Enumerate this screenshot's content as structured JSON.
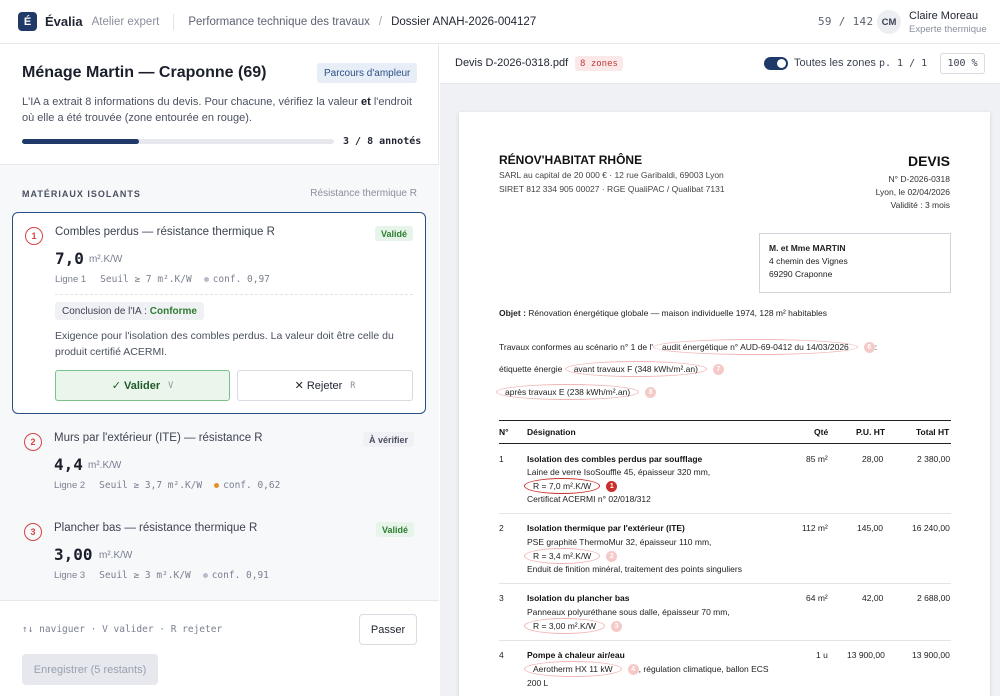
{
  "header": {
    "logo_letter": "É",
    "brand": "Évalia",
    "brand_sub": "Atelier expert",
    "crumb1": "Performance technique des travaux",
    "crumb_sep": "/",
    "crumb2": "Dossier ANAH-2026-004127",
    "counter": "59 / 142",
    "avatar": "CM",
    "user_name": "Claire Moreau",
    "user_role": "Experte thermique"
  },
  "case": {
    "title": "Ménage Martin — Craponne (69)",
    "tag": "Parcours d'ampleur",
    "intro_a": "L'IA a extrait 8 informations du devis. Pour chacune, vérifiez la valeur ",
    "intro_b": "et",
    "intro_c": " l'endroit où elle a été trouvée (zone entourée en rouge).",
    "progress_fraction": 0.375,
    "progress_label": "3 / 8 annotés"
  },
  "section": {
    "title": "MATÉRIAUX ISOLANTS",
    "unit": "Résistance thermique R"
  },
  "items": [
    {
      "num": "1",
      "title": "Combles perdus — résistance thermique R",
      "status": "Validé",
      "value": "7,0",
      "unit": "m².K/W",
      "line": "Ligne 1",
      "threshold": "Seuil ≥ 7 m².K/W",
      "conf": "conf. 0,97",
      "ia_label": "Conclusion de l'IA :",
      "ia_value": "Conforme",
      "ia_text": "Exigence pour l'isolation des combles perdus. La valeur doit être celle du produit certifié ACERMI.",
      "validate_label": "✓ Valider",
      "validate_key": "V",
      "reject_label": "✕ Rejeter",
      "reject_key": "R"
    },
    {
      "num": "2",
      "title": "Murs par l'extérieur (ITE) — résistance R",
      "status": "À vérifier",
      "value": "4,4",
      "unit": "m².K/W",
      "line": "Ligne 2",
      "threshold": "Seuil ≥ 3,7 m².K/W",
      "conf": "conf. 0,62"
    },
    {
      "num": "3",
      "title": "Plancher bas — résistance thermique R",
      "status": "Validé",
      "value": "3,00",
      "unit": "m².K/W",
      "line": "Ligne 3",
      "threshold": "Seuil ≥ 3 m².K/W",
      "conf": "conf. 0,91"
    }
  ],
  "footer": {
    "hint": "↑↓ naviguer · V valider · R rejeter",
    "skip": "Passer",
    "save": "Enregistrer (5 restants)"
  },
  "viewer": {
    "doc_name": "Devis D-2026-0318.pdf",
    "zones": "8 zones",
    "toggle_label": "Toutes les zones",
    "page": "p. 1 / 1",
    "zoom": "100 %"
  },
  "doc": {
    "company": "RÉNOV'HABITAT RHÔNE",
    "company_l1": "SARL au capital de 20 000 € · 12 rue Garibaldi, 69003 Lyon",
    "company_l2": "SIRET 812 334 905 00027 · RGE QualiPAC / Qualibat 7131",
    "devis": "DEVIS",
    "devis_no": "N° D-2026-0318",
    "devis_date": "Lyon, le 02/04/2026",
    "devis_valid": "Validité : 3 mois",
    "client_name": "M. et Mme MARTIN",
    "client_addr1": "4 chemin des Vignes",
    "client_addr2": "69290 Craponne",
    "objet_label": "Objet :",
    "objet": "Rénovation énergétique globale — maison individuelle 1974, 128 m² habitables",
    "scenario_pre": "Travaux conformes au scénario n° 1 de l'",
    "scenario_hl": "audit énergétique n° AUD-69-0412 du 14/03/2026",
    "scenario_zone": "6",
    "scenario_post": ":",
    "etiq_pre": "étiquette énergie",
    "etiq_hl": "avant travaux F (348 kWh/m².an)",
    "etiq_zone": "7",
    "after_hl": "après travaux E (238 kWh/m².an)",
    "after_zone": "8",
    "cols": [
      "N°",
      "Désignation",
      "Qté",
      "P.U. HT",
      "Total HT"
    ],
    "rows": [
      {
        "no": "1",
        "title": "Isolation des combles perdus par soufflage",
        "l1": "Laine de verre IsoSouffle 45, épaisseur 320 mm,",
        "hl": "R = 7,0 m².K/W",
        "zone": "1",
        "l3": "Certificat ACERMI n° 02/018/312",
        "qty": "85 m²",
        "pu": "28,00",
        "total": "2 380,00"
      },
      {
        "no": "2",
        "title": "Isolation thermique par l'extérieur (ITE)",
        "l1": "PSE graphité ThermoMur 32, épaisseur 110 mm,",
        "hl": "R = 3,4 m².K/W",
        "zone": "2",
        "l3": "Enduit de finition minéral, traitement des points singuliers",
        "qty": "112 m²",
        "pu": "145,00",
        "total": "16 240,00"
      },
      {
        "no": "3",
        "title": "Isolation du plancher bas",
        "l1": "Panneaux polyuréthane sous dalle, épaisseur 70 mm,",
        "hl": "R = 3,00 m².K/W",
        "zone": "3",
        "qty": "64 m²",
        "pu": "42,00",
        "total": "2 688,00"
      },
      {
        "no": "4",
        "title": "Pompe à chaleur air/eau",
        "hl": "Aerotherm HX 11 kW",
        "zone": "4",
        "l1_after": ", régulation climatique, ballon ECS",
        "l2": "200 L",
        "qty": "1 u",
        "pu": "13 900,00",
        "total": "13 900,00"
      }
    ]
  },
  "colors": {
    "accent": "#1f3a68",
    "zone_red": "#c9302c",
    "valid_green": "#2e7d32",
    "warn_orange": "#e0902a"
  }
}
